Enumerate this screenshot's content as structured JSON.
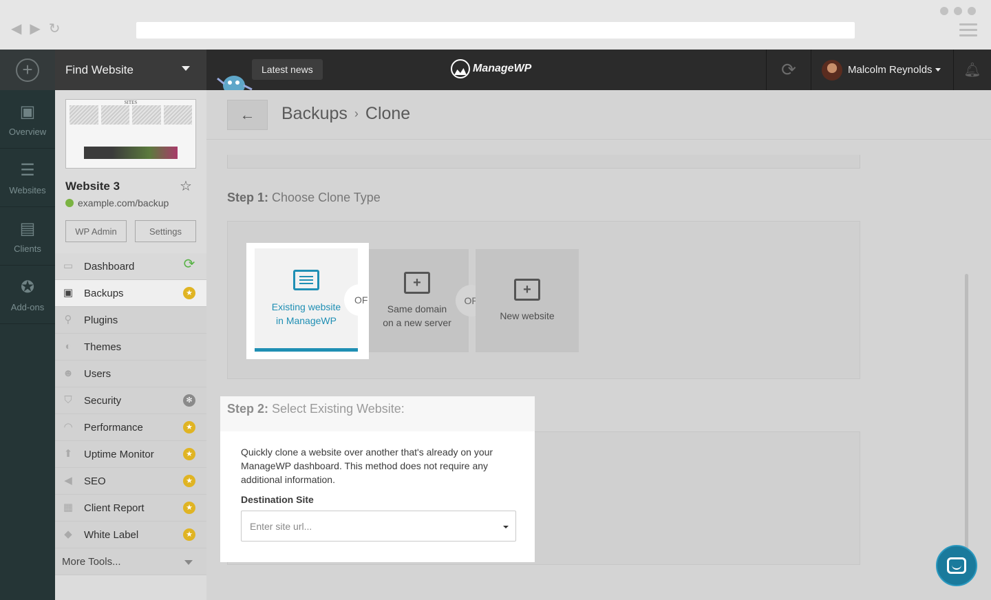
{
  "topbar": {
    "find_label": "Find Website",
    "news_label": "Latest news",
    "logo_text": "ManageWP",
    "user_name": "Malcolm Reynolds"
  },
  "rail": {
    "items": [
      {
        "label": "Overview",
        "icon": "overview-icon"
      },
      {
        "label": "Websites",
        "icon": "websites-icon"
      },
      {
        "label": "Clients",
        "icon": "clients-icon"
      },
      {
        "label": "Add-ons",
        "icon": "addons-icon"
      }
    ]
  },
  "site": {
    "title": "Website 3",
    "url": "example.com/backup",
    "wp_admin": "WP Admin",
    "settings": "Settings",
    "thumb_header": "SITES"
  },
  "menu": {
    "items": [
      {
        "label": "Dashboard",
        "icon": "monitor-icon",
        "badge": "sync"
      },
      {
        "label": "Backups",
        "icon": "backup-icon",
        "badge": "premium"
      },
      {
        "label": "Plugins",
        "icon": "plug-icon",
        "badge": ""
      },
      {
        "label": "Themes",
        "icon": "palette-icon",
        "badge": ""
      },
      {
        "label": "Users",
        "icon": "user-icon",
        "badge": ""
      },
      {
        "label": "Security",
        "icon": "shield-icon",
        "badge": "gray"
      },
      {
        "label": "Performance",
        "icon": "gauge-icon",
        "badge": "premium"
      },
      {
        "label": "Uptime Monitor",
        "icon": "arrow-up-icon",
        "badge": "premium"
      },
      {
        "label": "SEO",
        "icon": "megaphone-icon",
        "badge": "premium"
      },
      {
        "label": "Client Report",
        "icon": "chart-icon",
        "badge": "premium"
      },
      {
        "label": "White Label",
        "icon": "tag-icon",
        "badge": "premium"
      }
    ],
    "more": "More Tools..."
  },
  "breadcrumb": {
    "parent": "Backups",
    "separator": "›",
    "current": "Clone"
  },
  "step1": {
    "prefix": "Step 1:",
    "title": "Choose Clone Type",
    "options": [
      {
        "line1": "Existing website",
        "line2": "in ManageWP"
      },
      {
        "line1": "Same domain",
        "line2": "on a new server"
      },
      {
        "line1": "New website",
        "line2": ""
      }
    ],
    "or_label": "OR",
    "or_partial": "OF"
  },
  "step2": {
    "prefix": "Step 2:",
    "title": "Select Existing Website:",
    "description": "Quickly clone a website over another that's already on your ManageWP dashboard. This method does not require any additional information.",
    "field_label": "Destination Site",
    "placeholder": "Enter site url..."
  },
  "colors": {
    "accent": "#1f8fb4",
    "premium_badge": "#e0b423",
    "rail_bg": "#253536",
    "topbar_bg": "#2b2b2b"
  }
}
